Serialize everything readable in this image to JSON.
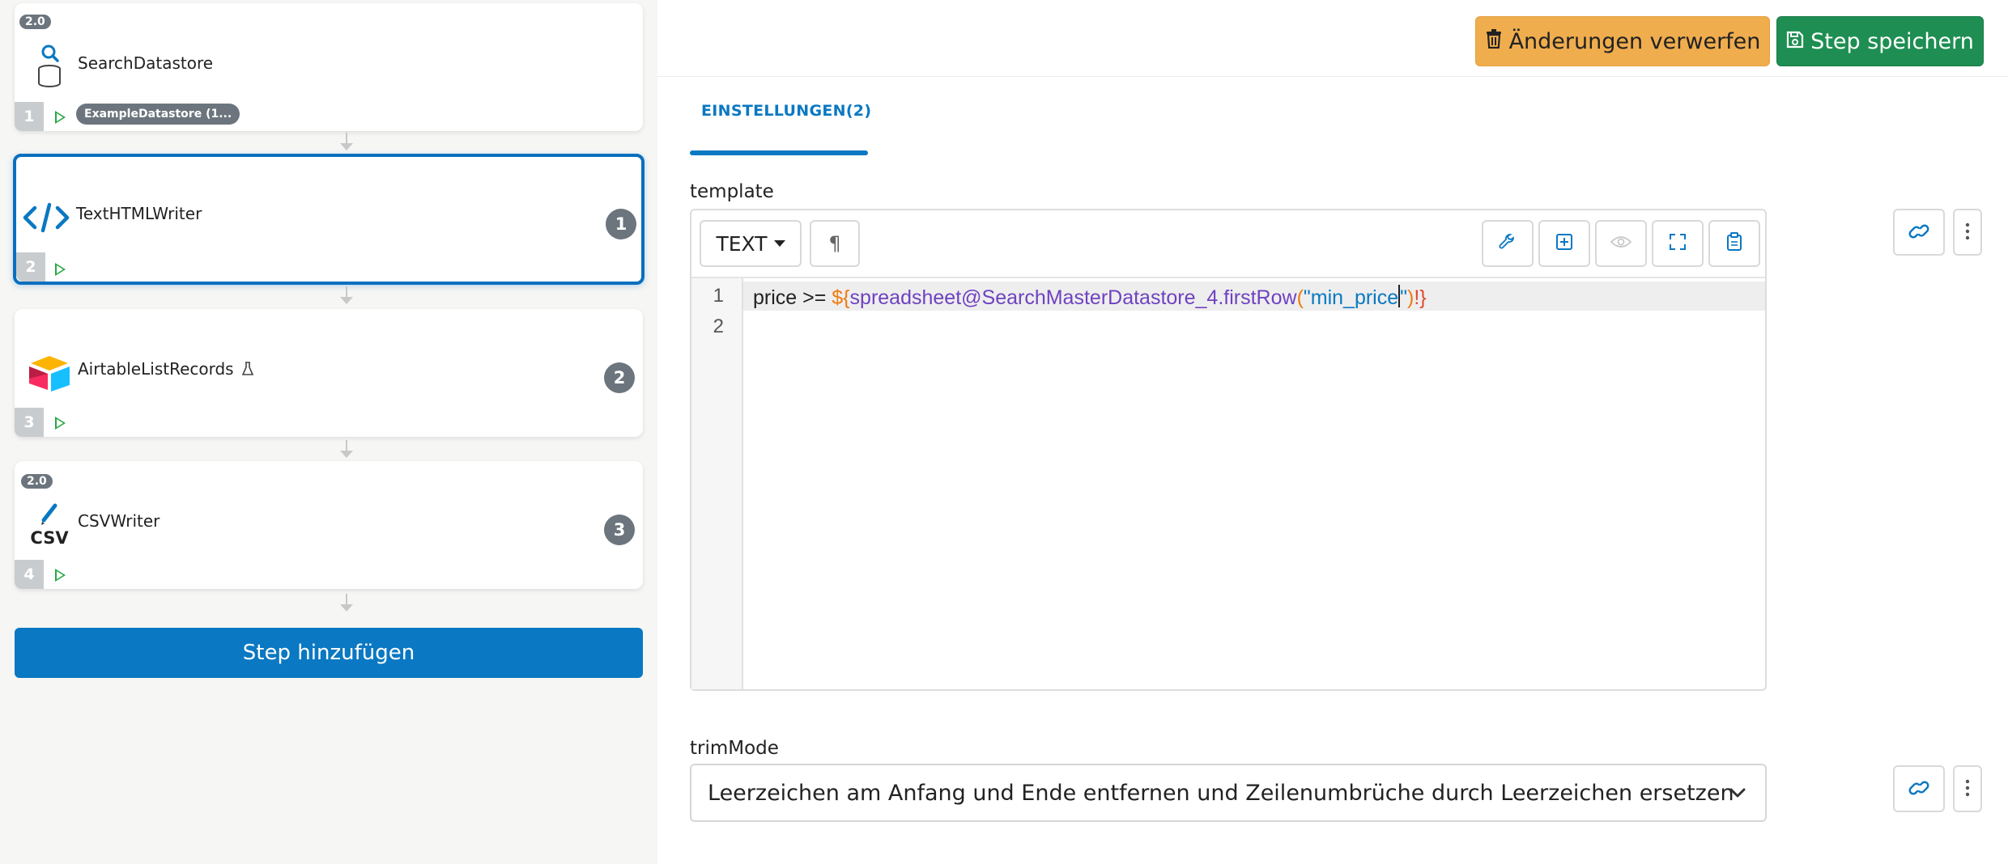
{
  "pipeline": {
    "steps": [
      {
        "number": "1",
        "title": "SearchDatastore",
        "version": "2.0",
        "tag": "ExampleDatastore (1...",
        "icon": "search-datastore-icon"
      },
      {
        "number": "2",
        "title": "TextHTMLWriter",
        "count": "1",
        "icon": "code-icon"
      },
      {
        "number": "3",
        "title": "AirtableListRecords",
        "count": "2",
        "icon": "airtable-icon",
        "beta_icon": "flask-icon"
      },
      {
        "number": "4",
        "title": "CSVWriter",
        "count": "3",
        "version": "2.0",
        "icon": "csv-pen-icon",
        "icon_text": "CSV"
      }
    ],
    "add_step_label": "Step hinzufügen"
  },
  "header": {
    "discard_label": "Änderungen verwerfen",
    "save_label": "Step speichern"
  },
  "tabs": [
    {
      "label": "EINSTELLUNGEN(2)",
      "active": true
    }
  ],
  "template_field": {
    "label": "template",
    "mode": "TEXT",
    "line_numbers": [
      "1",
      "2"
    ],
    "code": {
      "prefix": "price >= ",
      "open": "${",
      "var": "spreadsheet@SearchMasterDatastore_4.firstRow",
      "paren_open": "(",
      "quote_open": "\"",
      "string": "min_price",
      "quote_close": "\"",
      "paren_close": ")",
      "close": "!}"
    }
  },
  "trim_field": {
    "label": "trimMode",
    "value": "Leerzeichen am Anfang und Ende entfernen und Zeilenumbrüche durch Leerzeichen ersetzen"
  },
  "colors": {
    "primary": "#0a78c2",
    "warning": "#f0ad4e",
    "success": "#1e8e52",
    "badge": "#6c757d"
  }
}
